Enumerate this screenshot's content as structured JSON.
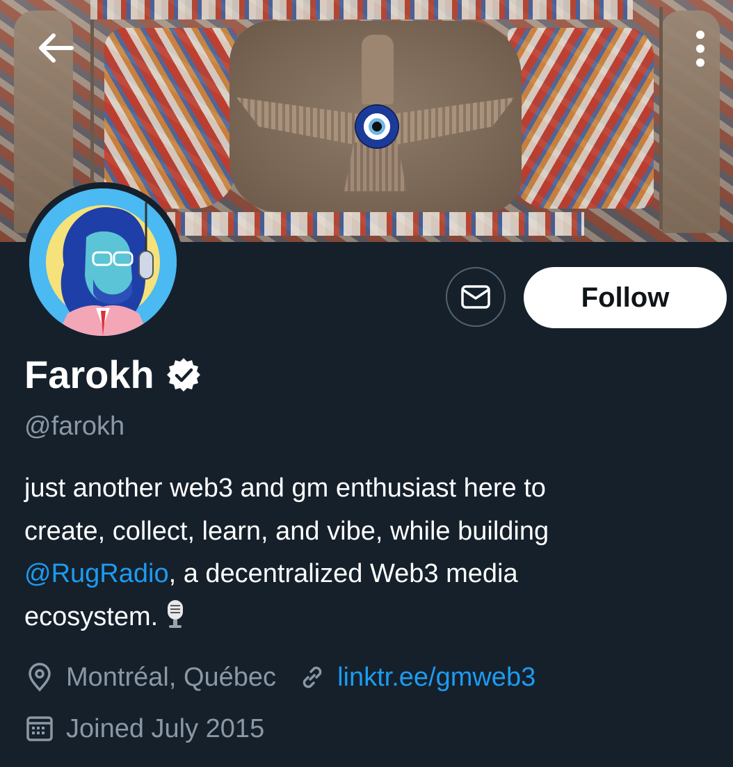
{
  "header": {
    "back_icon": "arrow-left-icon",
    "more_icon": "more-vertical-icon"
  },
  "actions": {
    "message_icon": "envelope-icon",
    "follow_label": "Follow"
  },
  "profile": {
    "name": "Farokh",
    "verified_icon": "verified-badge-icon",
    "handle": "@farokh",
    "bio": {
      "line1": "just another web3 and gm enthusiast here to",
      "line2": "create, collect, learn, and vibe, while building",
      "mention": "@RugRadio",
      "line3_rest": ", a decentralized Web3 media",
      "line4": "ecosystem.",
      "emoji_icon": "studio-microphone-icon"
    },
    "location": "Montréal, Québec",
    "location_icon": "location-pin-icon",
    "website": "linktr.ee/gmweb3",
    "website_icon": "link-icon",
    "joined": "Joined July 2015",
    "joined_icon": "calendar-icon"
  },
  "colors": {
    "background": "#15202b",
    "accent": "#1d9bf0",
    "secondary_text": "#8b98a5"
  }
}
